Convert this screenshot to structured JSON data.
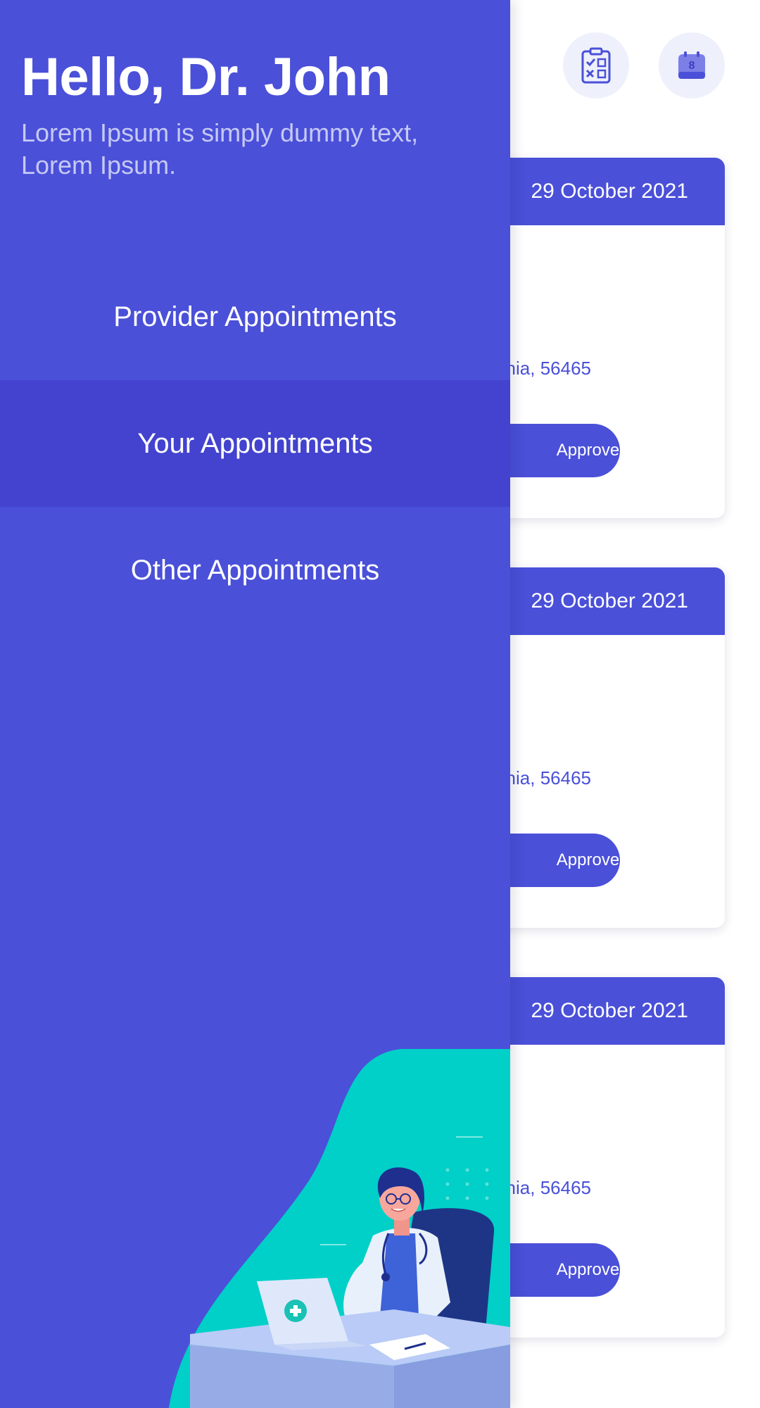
{
  "drawer": {
    "greeting": "Hello, Dr. John",
    "subtitle": "Lorem Ipsum is simply dummy text, Lorem Ipsum.",
    "menu": [
      {
        "label": "Provider Appointments",
        "selected": false
      },
      {
        "label": "Your Appointments",
        "selected": true
      },
      {
        "label": "Other Appointments",
        "selected": false
      }
    ]
  },
  "header": {
    "icons": [
      "checklist-icon",
      "calendar-icon"
    ],
    "calendar_day": "8"
  },
  "appointments": [
    {
      "date": "29 October 2021",
      "address_fragment": "nia, 56465",
      "action_label": "Approve"
    },
    {
      "date": "29 October 2021",
      "address_fragment": "nia, 56465",
      "action_label": "Approve"
    },
    {
      "date": "29 October 2021",
      "address_fragment": "nia, 56465",
      "action_label": "Approve"
    }
  ],
  "colors": {
    "primary": "#4a50d8",
    "selected_item": "#4343cf",
    "subtitle": "#c6c9f5",
    "icon_bg": "#eef0fb",
    "illustration_teal": "#00d0c8"
  }
}
